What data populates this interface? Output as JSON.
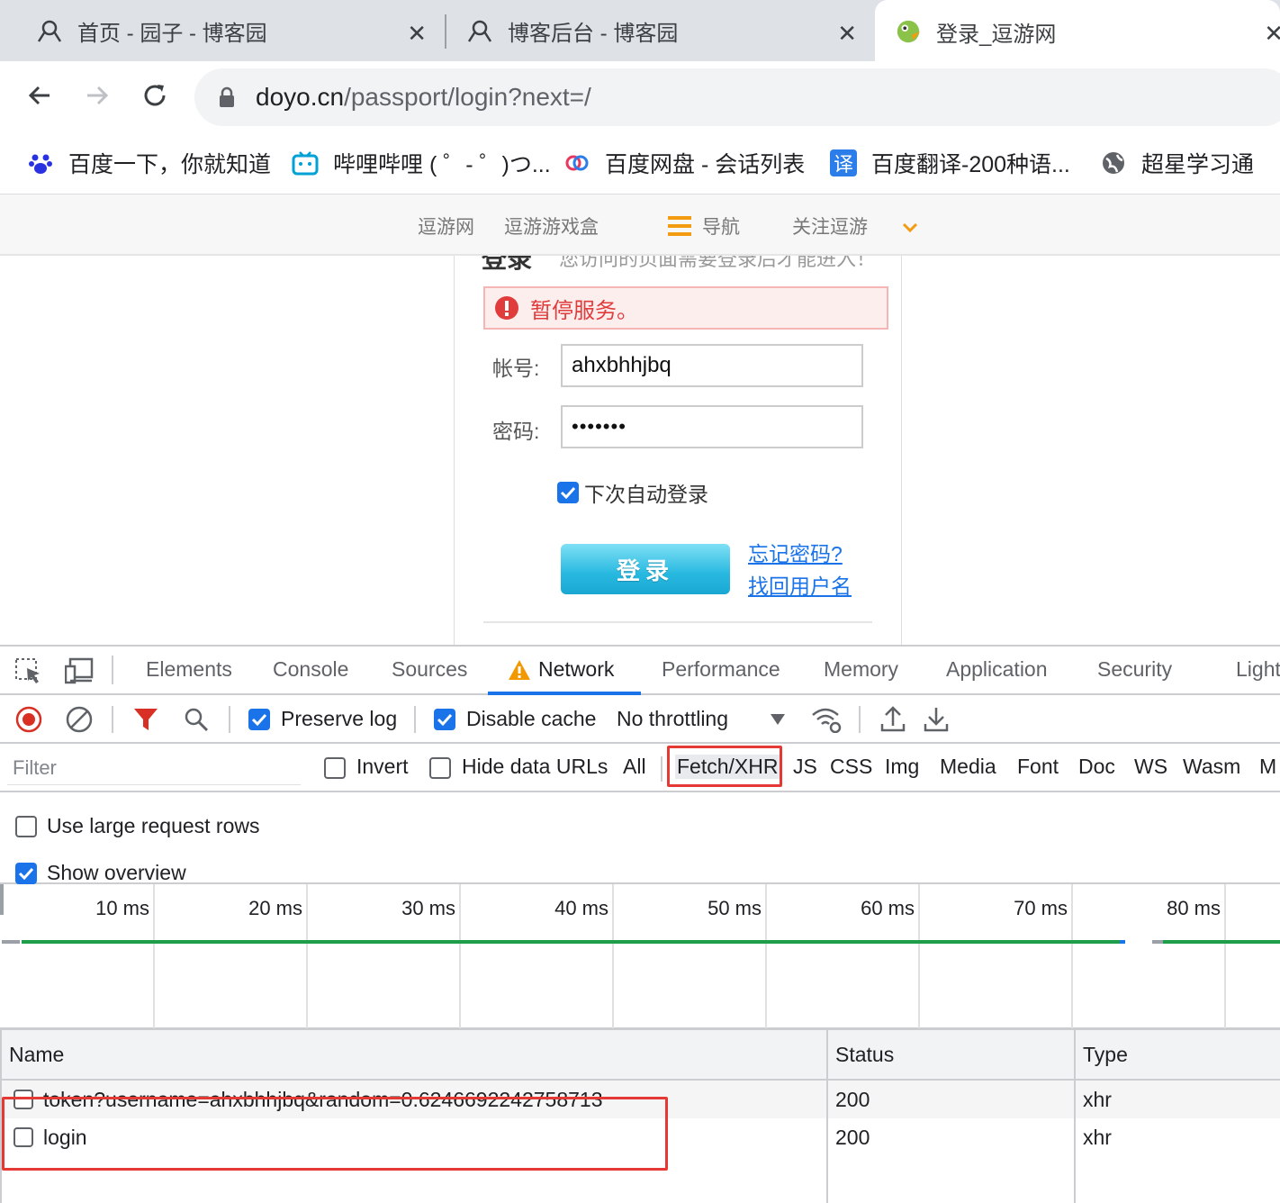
{
  "browser": {
    "tabs": [
      {
        "title": "首页 - 园子 - 博客园",
        "icon": "cnblogs-icon"
      },
      {
        "title": "博客后台 - 博客园",
        "icon": "cnblogs-icon"
      },
      {
        "title": "登录_逗游网",
        "icon": "doyo-icon",
        "active": true
      }
    ],
    "close_glyph": "✕",
    "url": {
      "host": "doyo.cn",
      "path": "/passport/login?next=/"
    },
    "bookmarks": [
      {
        "label": "百度一下，你就知道",
        "icon": "baidu-paw-icon"
      },
      {
        "label": "哔哩哔哩 ( ゜- ゜)つ...",
        "icon": "bilibili-tv-icon"
      },
      {
        "label": "百度网盘 - 会话列表",
        "icon": "baidu-netdisk-icon"
      },
      {
        "label": "百度翻译-200种语...",
        "icon": "translate-icon"
      },
      {
        "label": "超星学习通",
        "icon": "globe-icon"
      }
    ],
    "translate_glyph": "译"
  },
  "site_nav": {
    "items": [
      "逗游网",
      "逗游游戏盒",
      "导航",
      "关注逗游"
    ]
  },
  "login": {
    "cut_heading": "登录",
    "cut_hint": "您访问的页面需要登录后才能进入！",
    "alert": "暂停服务。",
    "account_label": "帐号:",
    "account_value": "ahxbhhjbq",
    "password_label": "密码:",
    "password_value": "•••••••",
    "remember_label": "下次自动登录",
    "remember_checked": true,
    "submit_label": "登录",
    "forgot_password": "忘记密码?",
    "find_username": "找回用户名"
  },
  "devtools": {
    "tabs": [
      "Elements",
      "Console",
      "Sources",
      "Network",
      "Performance",
      "Memory",
      "Application",
      "Security",
      "Light"
    ],
    "active_tab": "Network",
    "toolbar": {
      "preserve_log": "Preserve log",
      "preserve_log_checked": true,
      "disable_cache": "Disable cache",
      "disable_cache_checked": true,
      "throttling": "No throttling"
    },
    "filter": {
      "placeholder": "Filter",
      "invert": "Invert",
      "hide_data_urls": "Hide data URLs",
      "types": [
        "All",
        "Fetch/XHR",
        "JS",
        "CSS",
        "Img",
        "Media",
        "Font",
        "Doc",
        "WS",
        "Wasm",
        "M"
      ],
      "selected_type": "Fetch/XHR"
    },
    "settings": {
      "large_rows": "Use large request rows",
      "large_rows_checked": false,
      "show_overview": "Show overview",
      "show_overview_checked": true
    },
    "overview_ticks": [
      "10 ms",
      "20 ms",
      "30 ms",
      "40 ms",
      "50 ms",
      "60 ms",
      "70 ms",
      "80 ms"
    ],
    "table": {
      "columns": [
        "Name",
        "Status",
        "Type"
      ],
      "rows": [
        {
          "name": "token?username=ahxbhhjbq&random=0.6246692242758713",
          "status": "200",
          "type": "xhr"
        },
        {
          "name": "login",
          "status": "200",
          "type": "xhr"
        }
      ]
    }
  },
  "colors": {
    "accent": "#1a73e8",
    "highlight_red": "#e53935",
    "timeline_green": "#1e9e4a",
    "alert_text": "#e03c3c",
    "nav_arrow_orange": "#f39c12"
  }
}
